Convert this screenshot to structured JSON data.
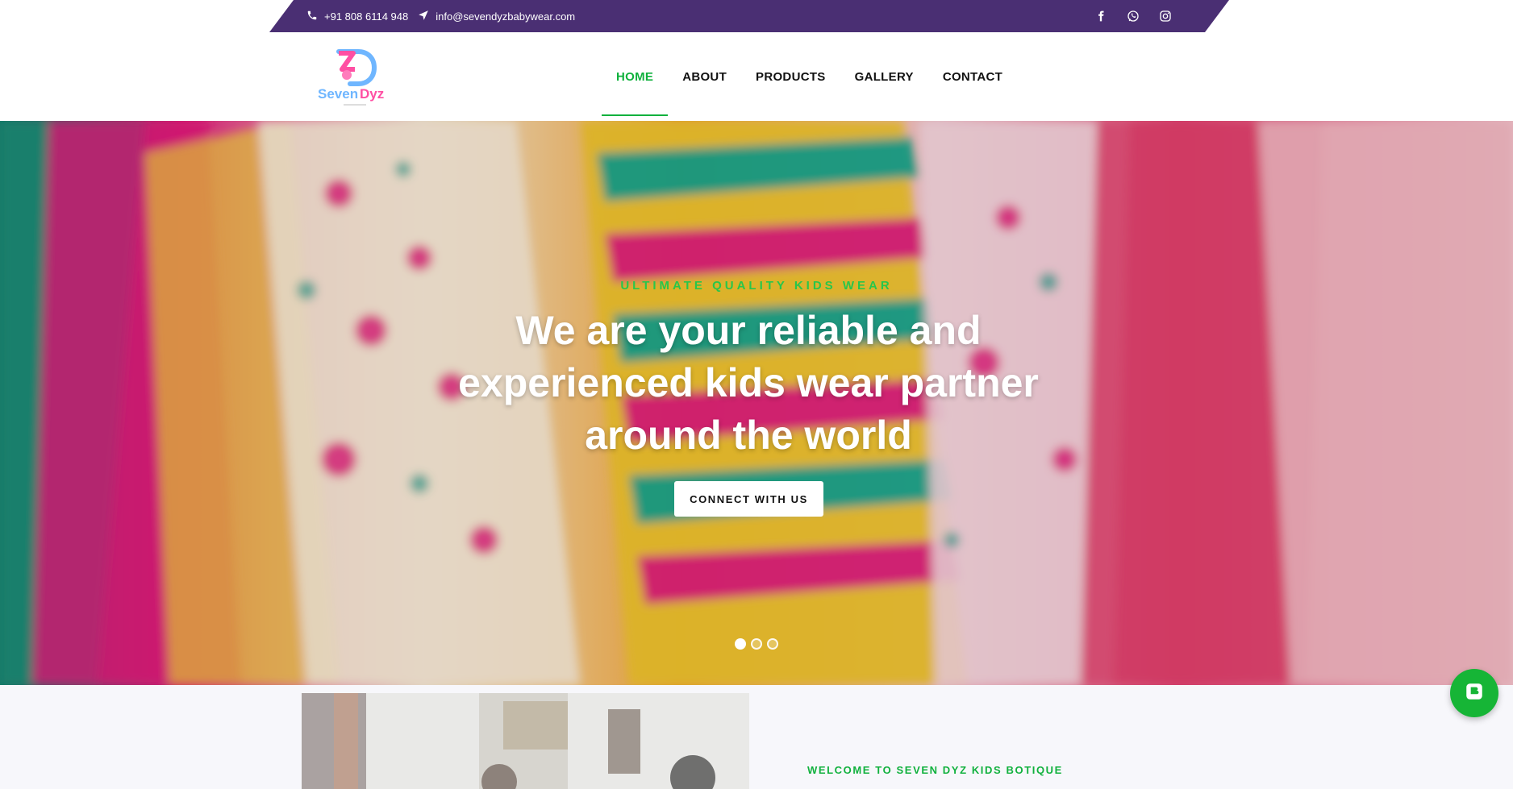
{
  "topbar": {
    "phone": "+91 808 6114 948",
    "email": "info@sevendyzbabywear.com",
    "social": [
      "facebook-icon",
      "whatsapp-icon",
      "instagram-icon"
    ],
    "color": "#4a2f73"
  },
  "brand": {
    "name": "Seven Dyz"
  },
  "nav": {
    "items": [
      {
        "label": "HOME",
        "active": true
      },
      {
        "label": "ABOUT",
        "active": false
      },
      {
        "label": "PRODUCTS",
        "active": false
      },
      {
        "label": "GALLERY",
        "active": false
      },
      {
        "label": "CONTACT",
        "active": false
      }
    ],
    "active_color": "#10b13d"
  },
  "hero": {
    "kicker": "ULTIMATE QUALITY KIDS WEAR",
    "title": "We are your reliable and experienced kids wear partner around the world",
    "button_label": "CONNECT WITH US",
    "slides": 3,
    "active_slide": 1
  },
  "welcome": {
    "kicker": "WELCOME TO SEVEN DYZ KIDS BOTIQUE"
  },
  "fab": {
    "icon": "chat-icon",
    "color": "#16b536"
  }
}
